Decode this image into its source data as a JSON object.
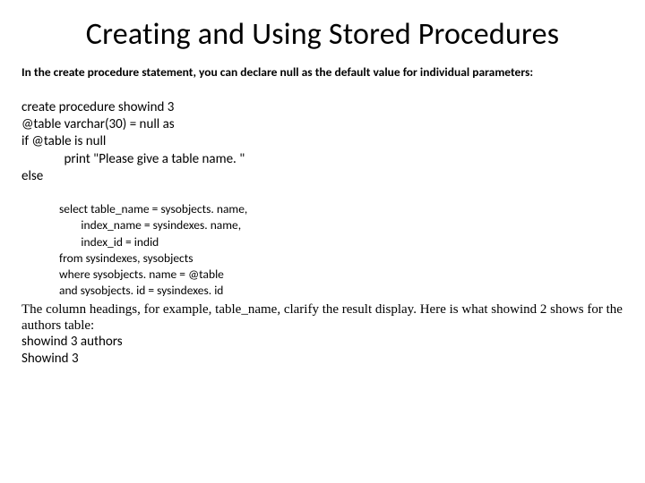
{
  "title": "Creating and Using Stored Procedures",
  "intro": "In the create procedure statement, you can declare null as the default value for individual parameters:",
  "code": {
    "l1": "create procedure showind 3",
    "l2": "@table varchar(30) = null as",
    "l3": "if @table is null",
    "l4": "              print \"Please give a table name. \"",
    "l5": "else",
    "s1": "select table_name = sysobjects. name,",
    "s2": "        index_name = sysindexes. name,",
    "s3": "        index_id = indid",
    "s4": "from sysindexes, sysobjects",
    "s5": "where sysobjects. name = @table",
    "s6": "and sysobjects. id = sysindexes. id"
  },
  "explain": "The column headings, for example, table_name, clarify the result display. Here is what showind 2 shows for the authors table:",
  "tail": {
    "l1": "showind 3 authors",
    "l2": "Showind 3"
  }
}
